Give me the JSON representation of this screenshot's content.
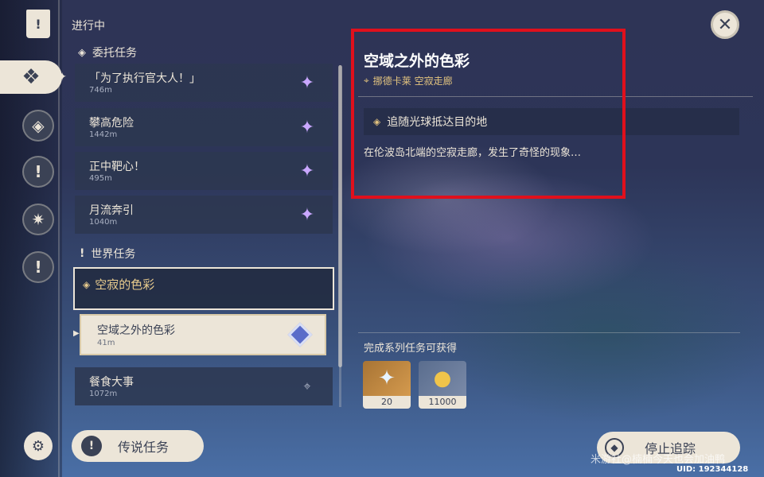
{
  "header": {
    "in_progress": "进行中"
  },
  "categories": {
    "commission": "委托任务",
    "world": "世界任务"
  },
  "commissions": [
    {
      "name": "「为了执行官大人！」",
      "distance": "746m"
    },
    {
      "name": "攀高危险",
      "distance": "1442m"
    },
    {
      "name": "正中靶心！",
      "distance": "495m"
    },
    {
      "name": "月流奔引",
      "distance": "1040m"
    }
  ],
  "world_quest": {
    "series": "空寂的色彩",
    "selected": {
      "name": "空域之外的色彩",
      "distance": "41m"
    },
    "other": {
      "name": "餐食大事",
      "distance": "1072m"
    }
  },
  "legend_button": "传说任务",
  "detail": {
    "title": "空域之外的色彩",
    "location": "挪德卡莱 空寂走廊",
    "objective": "追随光球抵达目的地",
    "description": "在伦波岛北端的空寂走廊，发生了奇怪的现象…",
    "rewards_title": "完成系列任务可获得",
    "rewards": [
      {
        "icon": "primogem-icon",
        "qty": "20"
      },
      {
        "icon": "mora-icon",
        "qty": "11000"
      }
    ]
  },
  "stop_tracking": "停止追踪",
  "watermark": "米游社@楠楠今天也会加油鸭",
  "uid": "UID: 192344128",
  "colors": {
    "accent_gold": "#e3c37f",
    "highlight_red": "#e0101c",
    "cream": "#ece5d8"
  }
}
